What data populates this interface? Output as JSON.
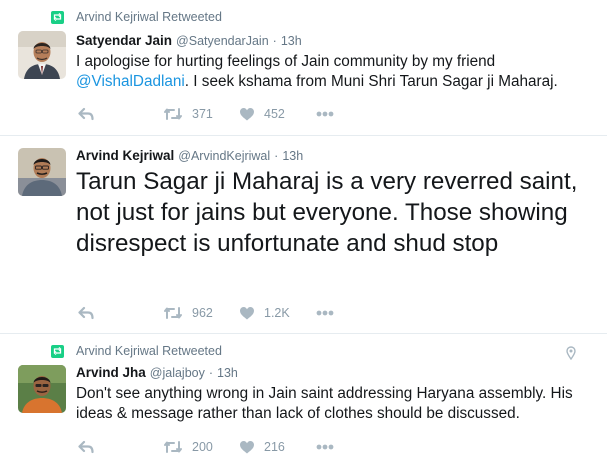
{
  "tweets": [
    {
      "retweeted_by": "Arvind Kejriwal Retweeted",
      "name": "Satyendar Jain",
      "handle": "@SatyendarJain",
      "time": "13h",
      "text_before": "I apologise for hurting feelings of Jain community  by my friend ",
      "mention": "@VishalDadlani",
      "text_after": ". I seek kshama from Muni Shri Tarun Sagar ji Maharaj.",
      "retweets": "371",
      "likes": "452"
    },
    {
      "name": "Arvind Kejriwal",
      "handle": "@ArvindKejriwal",
      "time": "13h",
      "text": "Tarun Sagar ji Maharaj is a very reverred saint, not just for jains but everyone. Those showing disrespect is unfortunate and shud stop",
      "retweets": "962",
      "likes": "1.2K"
    },
    {
      "retweeted_by": "Arvind Kejriwal Retweeted",
      "name": "Arvind Jha",
      "handle": "@jalajboy",
      "time": "13h",
      "text": "Don't see anything wrong in Jain saint addressing Haryana assembly. His ideas & message rather than lack of clothes should be discussed.",
      "retweets": "200",
      "likes": "216"
    }
  ],
  "separator": "·",
  "icons": {
    "retweet_context": "retweet-icon",
    "reply": "reply-icon",
    "retweet": "retweet-icon",
    "like": "heart-icon",
    "more": "more-dots-icon",
    "location": "location-pin-icon"
  },
  "colors": {
    "retweet_green": "#19cf86",
    "mention_blue": "#1b95e0",
    "muted_text": "#657786",
    "icon_gray": "#aab8c2",
    "text": "#14171a"
  }
}
